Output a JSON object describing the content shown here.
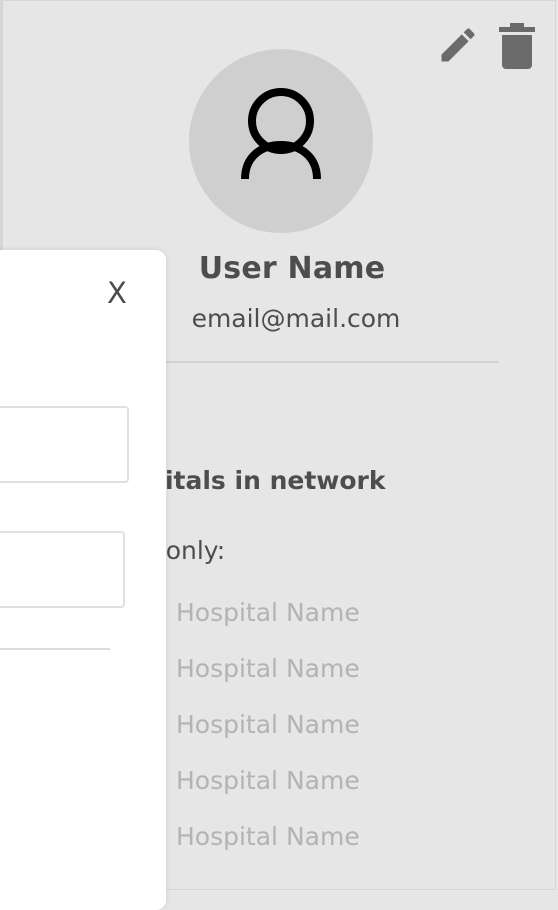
{
  "profile": {
    "name": "User Name",
    "email": "email@mail.com"
  },
  "hospitals": {
    "title": "ospitals in network",
    "view_only_label": "iew only:",
    "items": [
      {
        "name": "Hospital Name"
      },
      {
        "name": "Hospital Name"
      },
      {
        "name": "Hospital Name"
      },
      {
        "name": "Hospital Name"
      },
      {
        "name": "Hospital Name"
      }
    ]
  },
  "actions": {
    "edit_icon": "pencil-icon",
    "delete_icon": "trash-icon"
  },
  "panel": {
    "close_label": "X"
  },
  "colors": {
    "background": "#e6e6e6",
    "text_dark": "#4d4d4d",
    "text_muted": "#b3b3b3",
    "icon": "#6b6b6b",
    "avatar": "#cfcfcf",
    "panel": "#ffffff"
  }
}
